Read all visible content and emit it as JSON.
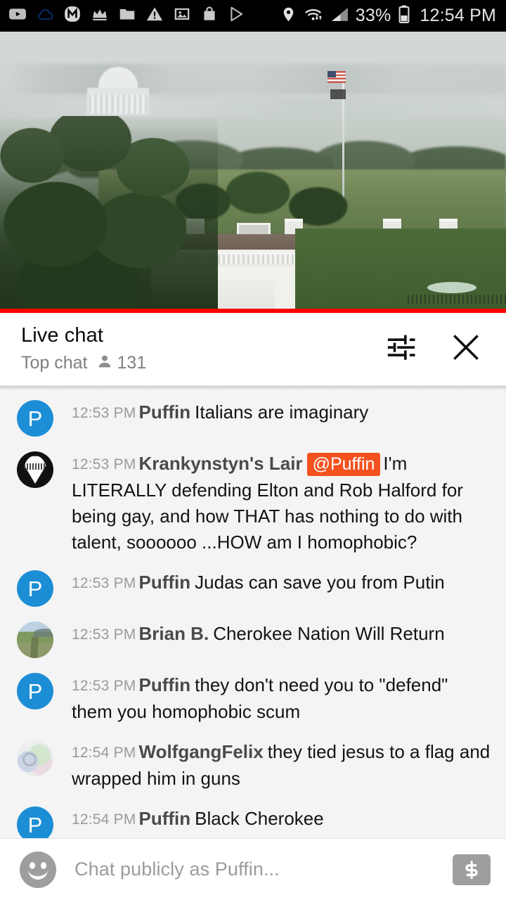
{
  "status_bar": {
    "icons": [
      "youtube-icon",
      "cloud-icon",
      "m-badge-icon",
      "crown-icon",
      "folder-icon",
      "warning-icon",
      "photo-icon",
      "shopping-bag-icon",
      "play-store-icon"
    ],
    "location_icon": "location-pin-icon",
    "wifi_icon": "wifi-transfer-icon",
    "signal_icon": "cell-signal-icon",
    "battery_percent": "33%",
    "battery_icon": "battery-icon",
    "clock": "12:54 PM"
  },
  "video": {
    "description": "White House live stream",
    "progress_color": "#ff0000",
    "progress_percent": 100
  },
  "chat_header": {
    "title": "Live chat",
    "mode_label": "Top chat",
    "viewers_icon": "person-icon",
    "viewers_count": "131",
    "settings_icon": "tune-sliders-icon",
    "close_icon": "close-x-icon"
  },
  "messages": [
    {
      "avatar_type": "initial",
      "avatar_initial": "P",
      "avatar_color": "#1c8ed6",
      "timestamp": "12:53 PM",
      "author": "Puffin",
      "mention": "",
      "text": "Italians are imaginary"
    },
    {
      "avatar_type": "pick",
      "avatar_initial": "",
      "avatar_color": "#111111",
      "timestamp": "12:53 PM",
      "author": "Krankynstyn's Lair",
      "mention": "@Puffin",
      "text": "I'm LITERALLY defending Elton and Rob Halford for being gay, and how THAT has nothing to do with talent, soooooo ...HOW am I homophobic?"
    },
    {
      "avatar_type": "initial",
      "avatar_initial": "P",
      "avatar_color": "#1c8ed6",
      "timestamp": "12:53 PM",
      "author": "Puffin",
      "mention": "",
      "text": "Judas can save you from Putin"
    },
    {
      "avatar_type": "landscape",
      "avatar_initial": "",
      "avatar_color": "#7e9a5e",
      "timestamp": "12:53 PM",
      "author": "Brian B.",
      "mention": "",
      "text": "Cherokee Nation Will Return"
    },
    {
      "avatar_type": "initial",
      "avatar_initial": "P",
      "avatar_color": "#1c8ed6",
      "timestamp": "12:53 PM",
      "author": "Puffin",
      "mention": "",
      "text": "they don't need you to \"defend\" them you homophobic scum"
    },
    {
      "avatar_type": "pastel",
      "avatar_initial": "",
      "avatar_color": "#e7eceb",
      "timestamp": "12:54 PM",
      "author": "WolfgangFelix",
      "mention": "",
      "text": "they tied jesus to a flag and wrapped him in guns"
    },
    {
      "avatar_type": "initial",
      "avatar_initial": "P",
      "avatar_color": "#1c8ed6",
      "timestamp": "12:54 PM",
      "author": "Puffin",
      "mention": "",
      "text": "Black Cherokee"
    }
  ],
  "chat_input": {
    "emoji_icon": "emoji-smiley-icon",
    "placeholder": "Chat publicly as Puffin...",
    "value": "",
    "superchat_icon": "dollar-sign-icon"
  }
}
